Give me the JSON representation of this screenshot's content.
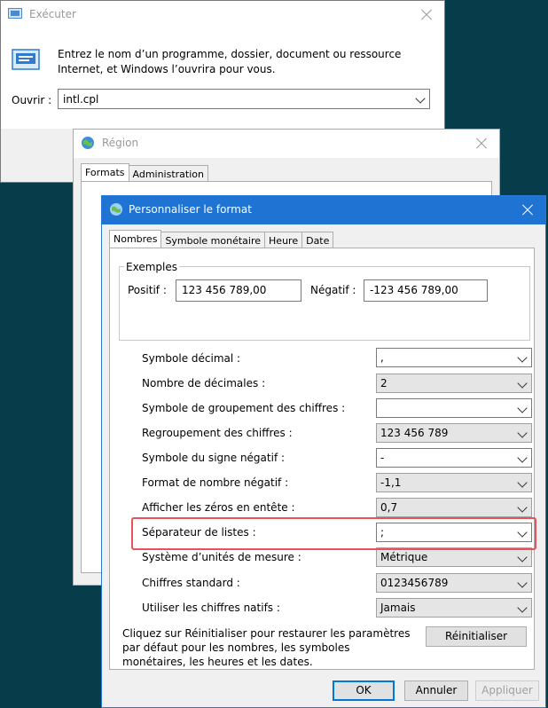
{
  "run": {
    "title": "Exécuter",
    "description": "Entrez le nom d’un programme, dossier, document ou ressource Internet, et Windows l’ouvrira pour vous.",
    "open_label": "Ouvrir :",
    "open_value": "intl.cpl"
  },
  "region": {
    "title": "Région",
    "tabs": [
      "Formats",
      "Administration"
    ]
  },
  "custom": {
    "title": "Personnaliser le format",
    "tabs": [
      "Nombres",
      "Symbole monétaire",
      "Heure",
      "Date"
    ],
    "examples": {
      "title": "Exemples",
      "positive_label": "Positif :",
      "positive_value": "123 456 789,00",
      "negative_label": "Négatif :",
      "negative_value": "-123 456 789,00"
    },
    "rows": [
      {
        "label": "Symbole décimal :",
        "value": ","
      },
      {
        "label": "Nombre de décimales :",
        "value": "2"
      },
      {
        "label": "Symbole de groupement des chiffres :",
        "value": ""
      },
      {
        "label": "Regroupement des chiffres :",
        "value": "123 456 789"
      },
      {
        "label": "Symbole du signe négatif :",
        "value": "-"
      },
      {
        "label": "Format de nombre négatif :",
        "value": "-1,1"
      },
      {
        "label": "Afficher les zéros en entête :",
        "value": "0,7"
      },
      {
        "label": "Séparateur de listes :",
        "value": ";"
      },
      {
        "label": "Système d’unités de mesure :",
        "value": "Métrique"
      },
      {
        "label": "Chiffres standard :",
        "value": "0123456789"
      },
      {
        "label": "Utiliser les chiffres natifs :",
        "value": "Jamais"
      }
    ],
    "info": "Cliquez sur Réinitialiser pour restaurer les paramètres par défaut pour les nombres, les symboles monétaires, les heures et les dates.",
    "reset_label": "Réinitialiser",
    "ok_label": "OK",
    "cancel_label": "Annuler",
    "apply_label": "Appliquer"
  },
  "colors": {
    "desktop": "#073c4b",
    "accent": "#1f73d3",
    "highlight": "#e8535a"
  }
}
